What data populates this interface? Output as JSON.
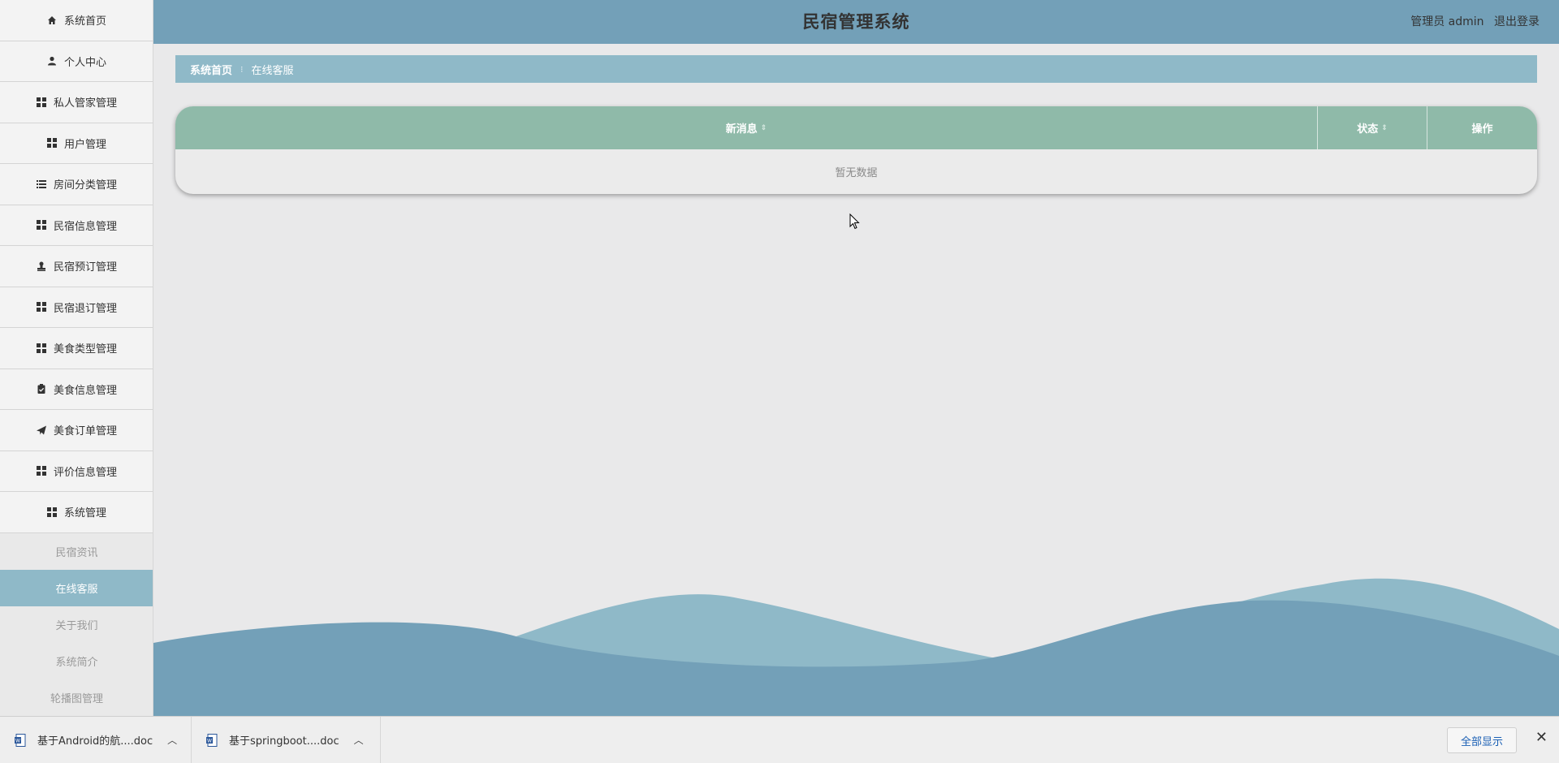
{
  "app": {
    "title": "民宿管理系统",
    "user_label": "管理员 admin",
    "logout_label": "退出登录"
  },
  "sidebar": {
    "items": [
      {
        "label": "系统首页",
        "icon": "home-icon"
      },
      {
        "label": "个人中心",
        "icon": "user-icon"
      },
      {
        "label": "私人管家管理",
        "icon": "grid-icon"
      },
      {
        "label": "用户管理",
        "icon": "grid-icon"
      },
      {
        "label": "房间分类管理",
        "icon": "list-icon"
      },
      {
        "label": "民宿信息管理",
        "icon": "grid-icon"
      },
      {
        "label": "民宿预订管理",
        "icon": "stamp-icon"
      },
      {
        "label": "民宿退订管理",
        "icon": "grid-icon"
      },
      {
        "label": "美食类型管理",
        "icon": "grid-icon"
      },
      {
        "label": "美食信息管理",
        "icon": "clipboard-icon"
      },
      {
        "label": "美食订单管理",
        "icon": "send-icon"
      },
      {
        "label": "评价信息管理",
        "icon": "grid-icon"
      },
      {
        "label": "系统管理",
        "icon": "grid-icon"
      }
    ],
    "submenu": [
      {
        "label": "民宿资讯"
      },
      {
        "label": "在线客服",
        "active": true
      },
      {
        "label": "关于我们"
      },
      {
        "label": "系统简介"
      },
      {
        "label": "轮播图管理"
      }
    ]
  },
  "breadcrumb": {
    "home": "系统首页",
    "current": "在线客服"
  },
  "table": {
    "columns": [
      "新消息",
      "状态",
      "操作"
    ],
    "empty_text": "暂无数据"
  },
  "downloads": {
    "items": [
      {
        "label": "基于Android的航....doc"
      },
      {
        "label": "基于springboot....doc"
      }
    ],
    "show_all_label": "全部显示"
  },
  "colors": {
    "header": "#73a0b8",
    "accent": "#8fb9c8",
    "table_header": "#8fbaa9"
  }
}
